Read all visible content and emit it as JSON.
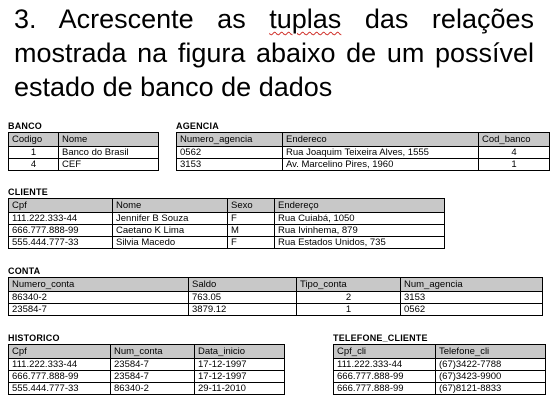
{
  "heading": {
    "part1": "3. Acrescente as ",
    "tuplas": "tuplas",
    "part2": " das relações mostrada na figura abaixo de um possível estado de banco de dados"
  },
  "banco": {
    "title": "BANCO",
    "headers": [
      "Codigo",
      "Nome"
    ],
    "rows": [
      [
        "1",
        "Banco do Brasil"
      ],
      [
        "4",
        "CEF"
      ]
    ]
  },
  "agencia": {
    "title": "AGENCIA",
    "headers": [
      "Numero_agencia",
      "Endereco",
      "Cod_banco"
    ],
    "rows": [
      [
        "0562",
        "Rua Joaquim Teixeira Alves, 1555",
        "4"
      ],
      [
        "3153",
        "Av. Marcelino Pires, 1960",
        "1"
      ]
    ]
  },
  "cliente": {
    "title": "CLIENTE",
    "headers": [
      "Cpf",
      "Nome",
      "Sexo",
      "Endereço"
    ],
    "rows": [
      [
        "111.222.333-44",
        "Jennifer B Souza",
        "F",
        "Rua Cuiabá, 1050"
      ],
      [
        "666.777.888-99",
        "Caetano K Lima",
        "M",
        "Rua Ivinhema, 879"
      ],
      [
        "555.444.777-33",
        "Silvia Macedo",
        "F",
        "Rua Estados Unidos, 735"
      ]
    ]
  },
  "conta": {
    "title": "CONTA",
    "headers": [
      "Numero_conta",
      "Saldo",
      "Tipo_conta",
      "Num_agencia"
    ],
    "rows": [
      [
        "86340-2",
        "763.05",
        "2",
        "3153"
      ],
      [
        "23584-7",
        "3879.12",
        "1",
        "0562"
      ]
    ]
  },
  "historico": {
    "title": "HISTORICO",
    "headers": [
      "Cpf",
      "Num_conta",
      "Data_inicio"
    ],
    "rows": [
      [
        "111.222.333-44",
        "23584-7",
        "17-12-1997"
      ],
      [
        "666.777.888-99",
        "23584-7",
        "17-12-1997"
      ],
      [
        "555.444.777-33",
        "86340-2",
        "29-11-2010"
      ]
    ]
  },
  "telefone_cliente": {
    "title": "TELEFONE_CLIENTE",
    "headers": [
      "Cpf_cli",
      "Telefone_cli"
    ],
    "rows": [
      [
        "111.222.333-44",
        "(67)3422-7788"
      ],
      [
        "666.777.888-99",
        "(67)3423-9900"
      ],
      [
        "666.777.888-99",
        "(67)8121-8833"
      ]
    ]
  }
}
